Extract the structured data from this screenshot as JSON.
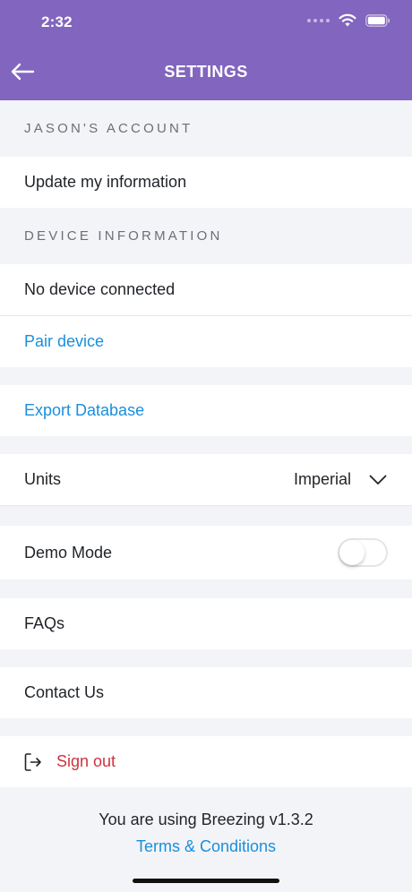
{
  "status_bar": {
    "time": "2:32"
  },
  "header": {
    "title": "SETTINGS"
  },
  "sections": {
    "account": {
      "label": "JASON'S ACCOUNT",
      "update_info": "Update my information"
    },
    "device": {
      "label": "DEVICE INFORMATION",
      "status": "No device connected",
      "pair": "Pair device"
    }
  },
  "export": {
    "label": "Export Database"
  },
  "units": {
    "label": "Units",
    "value": "Imperial"
  },
  "demo_mode": {
    "label": "Demo Mode",
    "enabled": false
  },
  "faqs": {
    "label": "FAQs"
  },
  "contact": {
    "label": "Contact Us"
  },
  "signout": {
    "label": "Sign out"
  },
  "footer": {
    "version_text": "You are using Breezing v1.3.2",
    "terms": "Terms & Conditions"
  },
  "colors": {
    "header": "#8265be",
    "link": "#1a8fdc",
    "danger": "#d0313f",
    "background": "#f3f4f7"
  },
  "icons": [
    "back-arrow-icon",
    "wifi-icon",
    "battery-icon",
    "chevron-down-icon",
    "sign-out-icon"
  ]
}
